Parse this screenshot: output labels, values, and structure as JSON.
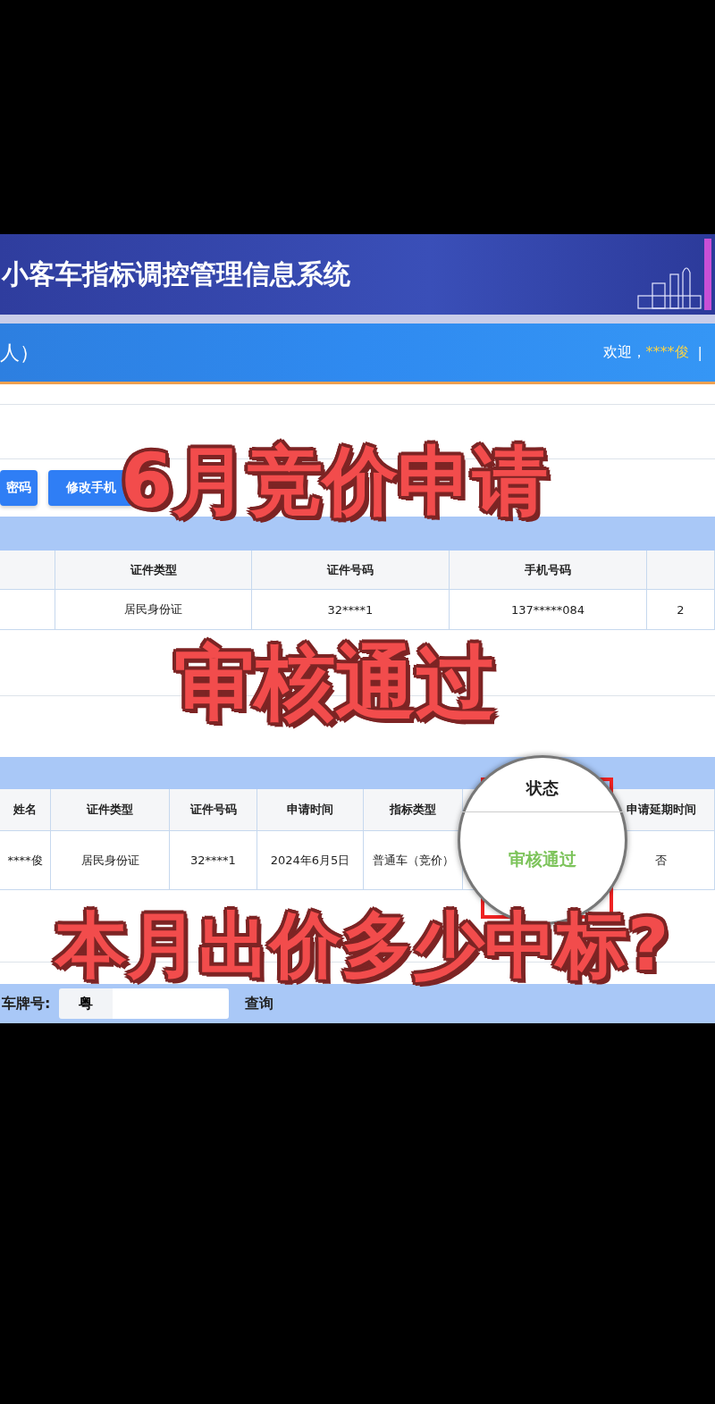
{
  "banner": {
    "title": "小客车指标调控管理信息系统"
  },
  "nav_bar": {
    "title": "人）",
    "welcome": "欢迎，",
    "user": "****俊",
    "separator": "|"
  },
  "buttons": [
    "密码",
    "修改手机"
  ],
  "person_table": {
    "columns": [
      "",
      "证件类型",
      "证件号码",
      "手机号码",
      ""
    ],
    "rows": [
      [
        "",
        "居民身份证",
        "32****1",
        "137*****084",
        "2"
      ]
    ]
  },
  "application_table": {
    "columns": [
      {
        "label": "姓名",
        "magnified": false
      },
      {
        "label": "证件类型",
        "magnified": false
      },
      {
        "label": "证件号码",
        "magnified": false
      },
      {
        "label": "申请时间",
        "magnified": false
      },
      {
        "label": "指标类型",
        "magnified": false
      },
      {
        "label": "状态",
        "magnified": true
      },
      {
        "label": "申请延期时间",
        "magnified": false
      }
    ],
    "rows": [
      [
        "****俊",
        "居民身份证",
        "32****1",
        "2024年6月5日",
        "普通车（竞价）",
        "审核通过",
        "否"
      ]
    ]
  },
  "plate_search": {
    "label": "车牌号:",
    "prefix": "粤",
    "button": "查询"
  },
  "captions": [
    "6月竞价申请",
    "审核通过",
    "本月出价多少中标?"
  ]
}
